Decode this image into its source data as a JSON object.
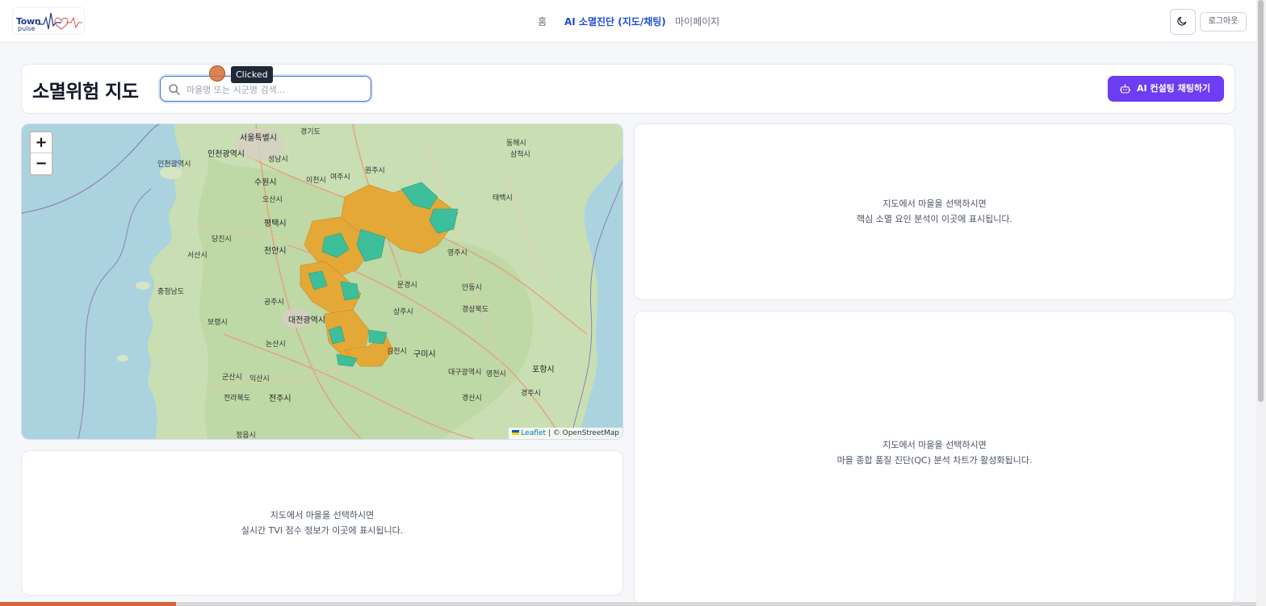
{
  "brand": {
    "line1": "Town",
    "line2": "pulse"
  },
  "nav": [
    {
      "label": "홈",
      "active": false
    },
    {
      "label": "AI 소멸진단 (지도/채팅)",
      "active": true
    },
    {
      "label": "마이페이지",
      "active": false
    }
  ],
  "header_actions": {
    "theme_icon": "moon-icon",
    "logout": "로그아웃"
  },
  "page": {
    "title": "소멸위험 지도",
    "search_placeholder": "마을명 또는 시군명 검색...",
    "search_value": "",
    "chat_button": "AI 컨설팅 채팅하기"
  },
  "click_marker": "Clicked",
  "map": {
    "zoom_in": "+",
    "zoom_out": "−",
    "attribution_link": "Leaflet",
    "attribution_text": "| © OpenStreetMap",
    "risk_colors": {
      "high": "#e3a836",
      "low": "#3cbf9a"
    },
    "labels": [
      "서울특별시",
      "경기도",
      "인천광역시",
      "성남시",
      "인천광역시",
      "수원시",
      "이천시",
      "여주시",
      "원주시",
      "동해시",
      "삼척시",
      "태백시",
      "평택시",
      "오산시",
      "당진시",
      "천안시",
      "서산시",
      "영주시",
      "충청남도",
      "문경시",
      "안동시",
      "공주시",
      "상주시",
      "경상북도",
      "보령시",
      "대전광역시",
      "논산시",
      "김천시",
      "구미시",
      "대구광역시",
      "영천시",
      "포항시",
      "군산시",
      "익산시",
      "경산시",
      "경주시",
      "전라북도",
      "전주시",
      "정읍시"
    ]
  },
  "panels": {
    "factors": {
      "line1": "지도에서 마을을 선택하시면",
      "line2": "핵심 소멸 요인 분석이 이곳에 표시됩니다."
    },
    "quality": {
      "line1": "지도에서 마을을 선택하시면",
      "line2": "마을 종합 품질 진단(QC) 분석 차트가 활성화됩니다."
    },
    "tvi": {
      "line1": "지도에서 마을을 선택하시면",
      "line2": "실시간 TVI 점수 정보가 이곳에 표시됩니다."
    }
  },
  "progress": {
    "percent": 14
  }
}
